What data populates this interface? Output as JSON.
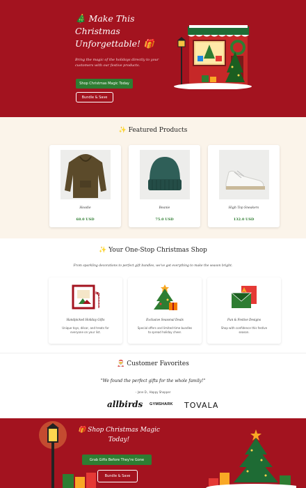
{
  "hero": {
    "title": "🎄 Make This Christmas Unforgettable! 🎁",
    "subtitle": "Bring the magic of the holidays directly to your customers with our festive products.",
    "primary_button": "Shop Christmas Magic Today",
    "secondary_button": "Bundle & Save"
  },
  "featured": {
    "title": "✨ Featured Products",
    "products": [
      {
        "name": "Hoodie",
        "price": "68.0 USD",
        "image": "hoodie-image"
      },
      {
        "name": "Beanie",
        "price": "75.0 USD",
        "image": "beanie-image"
      },
      {
        "name": "High Top Sneakers",
        "price": "132.0 USD",
        "image": "sneakers-image"
      }
    ]
  },
  "onestop": {
    "title": "✨ Your One-Stop Christmas Shop",
    "subtitle": "From sparkling decorations to perfect gift bundles, we've got everything to make the season bright.",
    "features": [
      {
        "title": "Handpicked Holiday Gifts",
        "desc": "Unique toys, décor, and treats for everyone on your list.",
        "icon": "fireplace-icon"
      },
      {
        "title": "Exclusive Seasonal Deals",
        "desc": "Special offers and limited-time bundles to spread holiday cheer.",
        "icon": "christmas-tree-icon"
      },
      {
        "title": "Fun & Festive Designs",
        "desc": "Shop with confidence this festive season.",
        "icon": "envelope-icon"
      }
    ]
  },
  "favorites": {
    "title": "🎅 Customer Favorites",
    "quote": "\"We found the perfect gifts for the whole family!\"",
    "author": "– Jane D., Happy Shopper",
    "logos": [
      "allbirds",
      "GYMSHARK",
      "TOVALA"
    ]
  },
  "cta": {
    "title": "🎁 Shop Christmas Magic Today!",
    "primary_button": "Grab Gifts Before They're Gone",
    "secondary_button": "Bundle & Save"
  },
  "colors": {
    "brand_red": "#a3131f",
    "brand_green": "#2e7d32",
    "cream": "#fbf4ea"
  }
}
